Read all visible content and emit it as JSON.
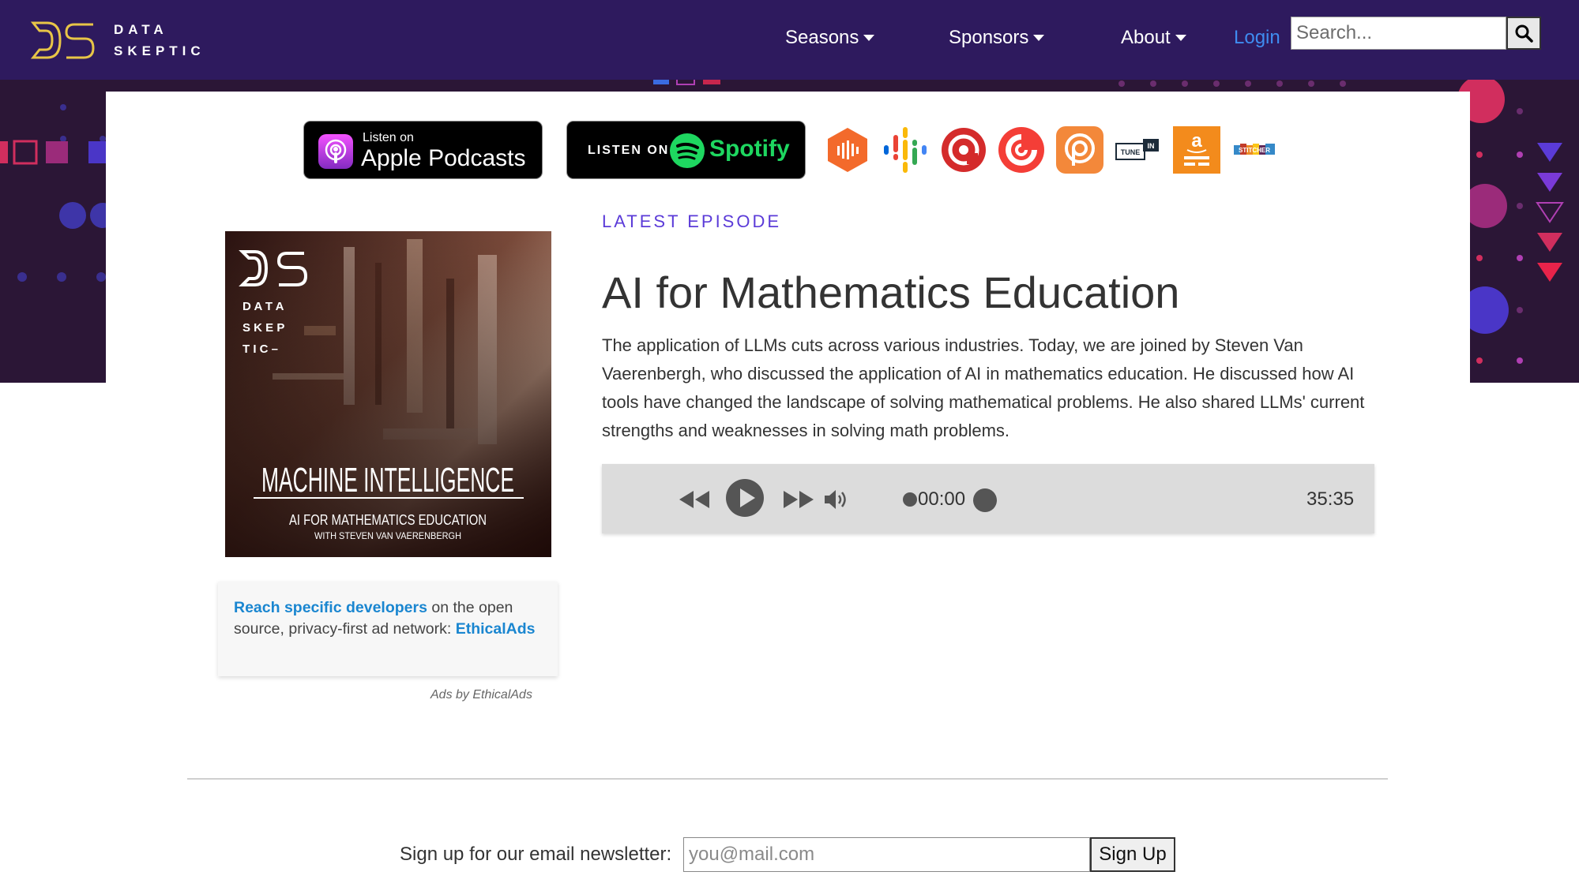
{
  "brand": {
    "line1": "DATA",
    "line2": "SKEPTIC",
    "logo_icon": "ds-logo-icon"
  },
  "nav": {
    "items": [
      {
        "label": "Seasons"
      },
      {
        "label": "Sponsors"
      },
      {
        "label": "About"
      }
    ],
    "login": "Login",
    "search_placeholder": "Search...",
    "search_icon": "search-icon"
  },
  "badges": {
    "apple": {
      "line1": "Listen on",
      "line2": "Apple Podcasts"
    },
    "spotify": {
      "prefix": "LISTEN ON",
      "name": "Spotify"
    }
  },
  "platforms": [
    {
      "name": "castbox-icon",
      "color": "#f36a2b"
    },
    {
      "name": "google-podcasts-icon",
      "color": "#4285f4"
    },
    {
      "name": "castro-icon",
      "color": "#d42b2b"
    },
    {
      "name": "pocket-casts-icon",
      "color": "#f43e37"
    },
    {
      "name": "podcast-addict-icon",
      "color": "#f3883a"
    },
    {
      "name": "tunein-icon",
      "color": "#1c2b39",
      "text": "TUNE IN"
    },
    {
      "name": "amazon-music-icon",
      "color": "#f38b1c",
      "text": "a"
    },
    {
      "name": "stitcher-icon",
      "color": "#3589c8",
      "text": "STITCHER"
    }
  ],
  "cover": {
    "brand": "DS",
    "brand_lines": [
      "D A T A",
      "S K E P",
      "T I C –"
    ],
    "series": "MACHINE INTELLIGENCE",
    "episode": "AI FOR MATHEMATICS EDUCATION",
    "guest": "WITH STEVEN VAN VAERENBERGH"
  },
  "latest": {
    "label": "LATEST EPISODE",
    "title": "AI for Mathematics Education",
    "description": "The application of LLMs cuts across various industries. Today, we are joined by Steven Van Vaerenbergh, who discussed the application of AI in mathematics education. He discussed how AI tools have changed the landscape of solving mathematical problems. He also shared LLMs' current strengths and weaknesses in solving math problems."
  },
  "player": {
    "current_time": "00:00",
    "duration": "35:35",
    "progress": 0.0
  },
  "ad": {
    "link_text": "Reach specific developers",
    "body": " on the open source, privacy-first ad network: ",
    "network": "EthicalAds",
    "attribution": "Ads by EthicalAds"
  },
  "newsletter": {
    "label": "Sign up for our email newsletter:",
    "placeholder": "you@mail.com",
    "button": "Sign Up"
  }
}
